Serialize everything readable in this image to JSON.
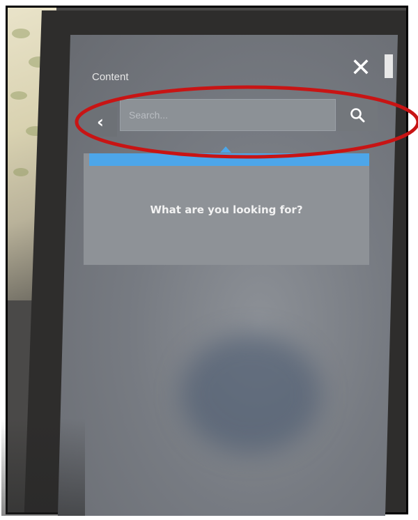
{
  "panel": {
    "title": "Content"
  },
  "search": {
    "placeholder": "Search...",
    "value": ""
  },
  "dropdown": {
    "message": "What are you looking for?"
  },
  "colors": {
    "accent": "#4da6e9",
    "annotation": "#c81414"
  },
  "icons": {
    "close": "close-icon",
    "back": "chevron-left-icon",
    "search": "search-icon"
  }
}
